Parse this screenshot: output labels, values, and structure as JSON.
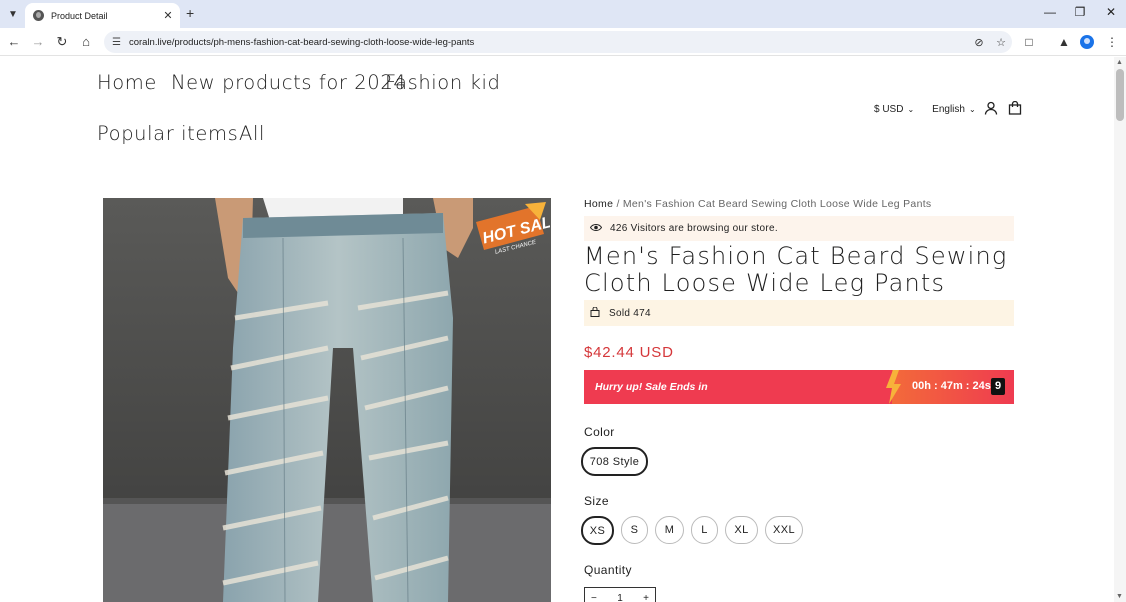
{
  "browser": {
    "tab_title": "Product Detail",
    "url": "coraln.live/products/ph-mens-fashion-cat-beard-sewing-cloth-loose-wide-leg-pants"
  },
  "nav": {
    "items": [
      "Home",
      "New products for 2024",
      "Fashion kid",
      "Popular items",
      "All"
    ]
  },
  "header": {
    "currency": "$ USD",
    "language": "English"
  },
  "product_image": {
    "badge_main": "HOT SALE",
    "badge_sub": "LAST CHANCE"
  },
  "product": {
    "breadcrumb_home": "Home",
    "breadcrumb_sep": "/",
    "breadcrumb_current": "Men's Fashion Cat Beard Sewing Cloth Loose Wide Leg Pants",
    "visitors": "426 Visitors are browsing our store.",
    "title": "Men's Fashion Cat Beard Sewing Cloth Loose Wide Leg Pants",
    "sold": "Sold 474",
    "price": "$42.44 USD",
    "sale_text": "Hurry up! Sale Ends in",
    "timer": "00h : 47m : 24s",
    "timer_seconds_digit": "9",
    "color_label": "Color",
    "colors": [
      "708 Style"
    ],
    "size_label": "Size",
    "sizes": [
      "XS",
      "S",
      "M",
      "L",
      "XL",
      "XXL"
    ],
    "selected_size": "XS",
    "quantity_label": "Quantity",
    "quantity": "1",
    "minus": "−",
    "plus": "+"
  },
  "colors": {
    "price_red": "#d5373a",
    "sale_bar": "#ef3b50",
    "info_bg": "#fdf4ec"
  }
}
